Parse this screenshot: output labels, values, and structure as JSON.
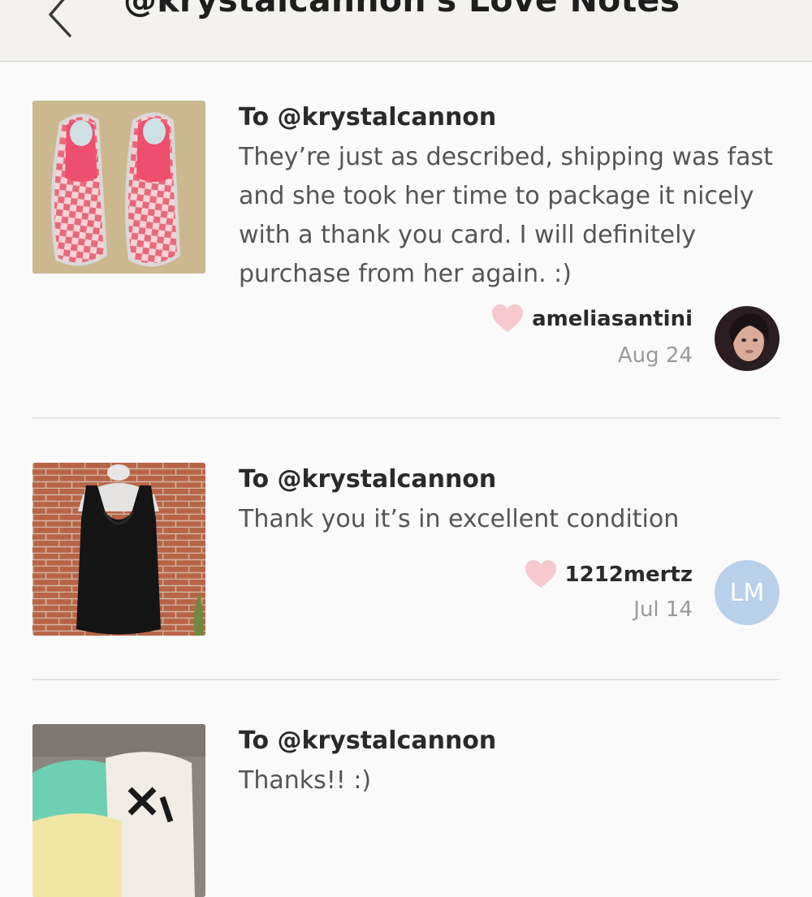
{
  "header": {
    "title": "@krystalcannon's Love Notes"
  },
  "notes": [
    {
      "to": "To @krystalcannon",
      "text": "They’re just as described, shipping was fast and she took her time to package it nicely with a thank you card. I will definitely purchase from her again. :)",
      "author": "ameliasantini",
      "date": "Aug 24",
      "item": "pink checkered slip-on shoes"
    },
    {
      "to": "To @krystalcannon",
      "text": "Thank you it’s in excellent condition",
      "author": "1212mertz",
      "date": "Jul 14",
      "avatar_initials": "LM",
      "item": "black draped tank top"
    },
    {
      "to": "To @krystalcannon",
      "text": "Thanks!! :)",
      "item": "folded clothing items"
    }
  ],
  "icons": {
    "back": "chevron-left-icon",
    "heart": "heart-icon"
  },
  "colors": {
    "heart": "#f6c9cf",
    "avatar_initials_bg": "#b8d0ea",
    "header_bg": "#f4f2ef",
    "page_bg": "#fbfafa"
  }
}
